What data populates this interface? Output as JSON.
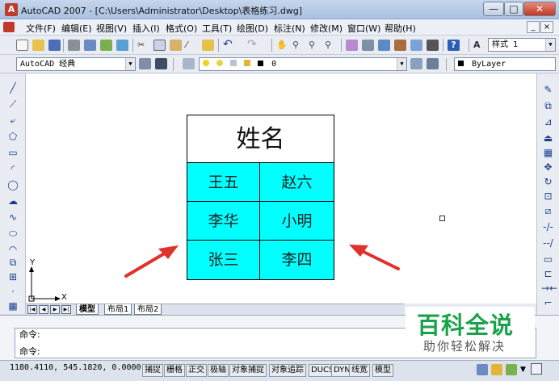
{
  "window": {
    "title": "AutoCAD 2007 - [C:\\Users\\Administrator\\Desktop\\表格练习.dwg]",
    "app_icon": "autocad-icon",
    "controls": [
      "minimize-icon",
      "maximize-icon",
      "close-icon"
    ]
  },
  "menu": {
    "items": [
      "文件(F)",
      "编辑(E)",
      "视图(V)",
      "插入(I)",
      "格式(O)",
      "工具(T)",
      "绘图(D)",
      "标注(N)",
      "修改(M)",
      "窗口(W)",
      "帮助(H)"
    ]
  },
  "toolbar_styles": {
    "text_style": "样式 1"
  },
  "toolbar_workspace": {
    "workspace": "AutoCAD 经典",
    "layer": "0",
    "color": "ByLayer"
  },
  "drawing": {
    "table_header": "姓名",
    "rows": [
      [
        "王五",
        "赵六"
      ],
      [
        "李华",
        "小明"
      ],
      [
        "张三",
        "李四"
      ]
    ],
    "table_fill_color": "#00ffff",
    "arrow_color": "#e0312a",
    "ucs_y": "Y",
    "ucs_x": "X"
  },
  "layout_tabs": [
    "模型",
    "布局1",
    "布局2"
  ],
  "command": {
    "line1": "命令:",
    "line2": "命令:"
  },
  "status": {
    "coords": "1180.4110,  545.1820,  0.0000",
    "buttons": [
      "捕捉",
      "栅格",
      "正交",
      "极轴",
      "对象捕捉",
      "对象追踪",
      "DUCS",
      "DYN",
      "线宽",
      "模型"
    ]
  },
  "watermark": {
    "title": "百科全说",
    "subtitle": "助你轻松解决"
  }
}
